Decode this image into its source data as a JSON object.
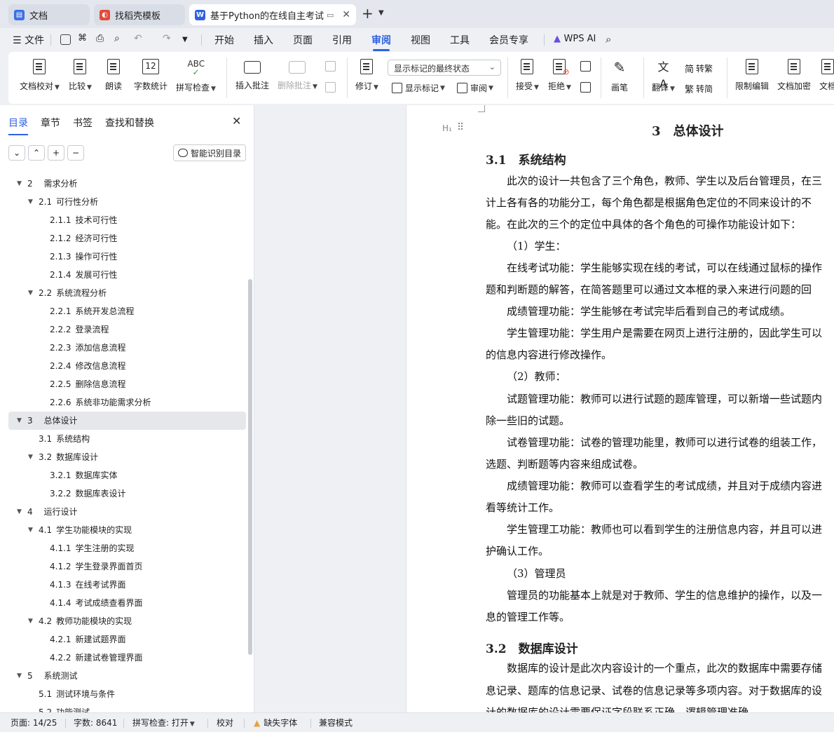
{
  "tabs": [
    {
      "label": "文档",
      "icon": "wps-docs-icon",
      "color": "#3b6fe6"
    },
    {
      "label": "找稻壳模板",
      "icon": "docer-icon",
      "color": "#e5493a"
    },
    {
      "label": "基于Python的在线自主考试系",
      "icon": "word-doc-icon",
      "color": "#2f62e0"
    }
  ],
  "menu": {
    "file": "文件",
    "items": [
      "开始",
      "插入",
      "页面",
      "引用",
      "审阅",
      "视图",
      "工具",
      "会员专享"
    ],
    "active": "审阅",
    "wps_ai": "WPS AI"
  },
  "ribbon": {
    "doc_proofread": "文档校对",
    "compare": "比较",
    "read_aloud": "朗读",
    "word_count": "字数统计",
    "spell_check": "拼写检查",
    "insert_comment": "插入批注",
    "delete_comment": "删除批注",
    "track_changes": "修订",
    "markup_state": "显示标记的最终状态",
    "show_markup": "显示标记",
    "review": "审阅",
    "accept": "接受",
    "reject": "拒绝",
    "brush": "画笔",
    "translate": "翻译",
    "to_traditional": "转繁",
    "to_simplified": "转简",
    "restrict_edit": "限制编辑",
    "encrypt": "文档加密",
    "doc_more": "文档"
  },
  "nav": {
    "tabs": [
      "目录",
      "章节",
      "书签",
      "查找和替换"
    ],
    "active_tab": "目录",
    "smart_toc": "智能识别目录",
    "toc": [
      {
        "num": "2",
        "title": "需求分析",
        "level": 1,
        "arrow": true
      },
      {
        "num": "2.1",
        "title": "可行性分析",
        "level": 2,
        "arrow": true
      },
      {
        "num": "2.1.1",
        "title": "技术可行性",
        "level": 3
      },
      {
        "num": "2.1.2",
        "title": "经济可行性",
        "level": 3
      },
      {
        "num": "2.1.3",
        "title": "操作可行性",
        "level": 3
      },
      {
        "num": "2.1.4",
        "title": "发展可行性",
        "level": 3
      },
      {
        "num": "2.2",
        "title": "系统流程分析",
        "level": 2,
        "arrow": true
      },
      {
        "num": "2.2.1",
        "title": "系统开发总流程",
        "level": 3
      },
      {
        "num": "2.2.2",
        "title": "登录流程",
        "level": 3
      },
      {
        "num": "2.2.3",
        "title": "添加信息流程",
        "level": 3
      },
      {
        "num": "2.2.4",
        "title": "修改信息流程",
        "level": 3
      },
      {
        "num": "2.2.5",
        "title": "删除信息流程",
        "level": 3
      },
      {
        "num": "2.2.6",
        "title": "系统非功能需求分析",
        "level": 3
      },
      {
        "num": "3",
        "title": "总体设计",
        "level": 1,
        "arrow": true,
        "selected": true
      },
      {
        "num": "3.1",
        "title": "系统结构",
        "level": 2
      },
      {
        "num": "3.2",
        "title": "数据库设计",
        "level": 2,
        "arrow": true
      },
      {
        "num": "3.2.1",
        "title": "数据库实体",
        "level": 3
      },
      {
        "num": "3.2.2",
        "title": "数据库表设计",
        "level": 3
      },
      {
        "num": "4",
        "title": "运行设计",
        "level": 1,
        "arrow": true
      },
      {
        "num": "4.1",
        "title": "学生功能模块的实现",
        "level": 2,
        "arrow": true
      },
      {
        "num": "4.1.1",
        "title": "学生注册的实现",
        "level": 3
      },
      {
        "num": "4.1.2",
        "title": "学生登录界面首页",
        "level": 3
      },
      {
        "num": "4.1.3",
        "title": "在线考试界面",
        "level": 3
      },
      {
        "num": "4.1.4",
        "title": "考试成绩查看界面",
        "level": 3
      },
      {
        "num": "4.2",
        "title": "教师功能模块的实现",
        "level": 2,
        "arrow": true
      },
      {
        "num": "4.2.1",
        "title": "新建试题界面",
        "level": 3
      },
      {
        "num": "4.2.2",
        "title": "新建试卷管理界面",
        "level": 3
      },
      {
        "num": "5",
        "title": "系统测试",
        "level": 1,
        "arrow": true
      },
      {
        "num": "5.1",
        "title": "测试环境与条件",
        "level": 2
      },
      {
        "num": "5.2",
        "title": "功能测试",
        "level": 2
      }
    ]
  },
  "document": {
    "chapter_title": "3　总体设计",
    "heading_mark": "H₁",
    "sections": [
      {
        "title": "3.1　系统结构"
      },
      {
        "title": "3.2　数据库设计"
      }
    ],
    "lines": [
      "此次的设计一共包含了三个角色，教师、学生以及后台管理员，在三",
      "计上各有各的功能分工，每个角色都是根据角色定位的不同来设计的不",
      "能。在此次的三个的定位中具体的各个角色的可操作功能设计如下：",
      "（1）学生：",
      "在线考试功能：学生能够实现在线的考试，可以在线通过鼠标的操作",
      "题和判断题的解答，在简答题里可以通过文本框的录入来进行问题的回",
      "成绩管理功能：学生能够在考试完毕后看到自己的考试成绩。",
      "学生管理功能：学生用户是需要在网页上进行注册的，因此学生可以",
      "的信息内容进行修改操作。",
      "（2）教师：",
      "试题管理功能：教师可以进行试题的题库管理，可以新增一些试题内",
      "除一些旧的试题。",
      "试卷管理功能：试卷的管理功能里，教师可以进行试卷的组装工作，",
      "选题、判断题等内容来组成试卷。",
      "成绩管理功能：教师可以查看学生的考试成绩，并且对于成绩内容进",
      "看等统计工作。",
      "学生管理工功能：教师也可以看到学生的注册信息内容，并且可以进",
      "护确认工作。",
      "（3）管理员",
      "管理员的功能基本上就是对于教师、学生的信息维护的操作，以及一",
      "息的管理工作等。",
      "数据库的设计是此次内容设计的一个重点，此次的数据库中需要存储",
      "息记录、题库的信息记录、试卷的信息记录等多项内容。对于数据库的设",
      "计的数据库的设计需要保证字段联系正确，逻辑管理准确，"
    ]
  },
  "status": {
    "page": "页面: 14/25",
    "words": "字数: 8641",
    "spell": "拼写检查: 打开",
    "proof": "校对",
    "missing_font": "缺失字体",
    "compat": "兼容模式"
  }
}
